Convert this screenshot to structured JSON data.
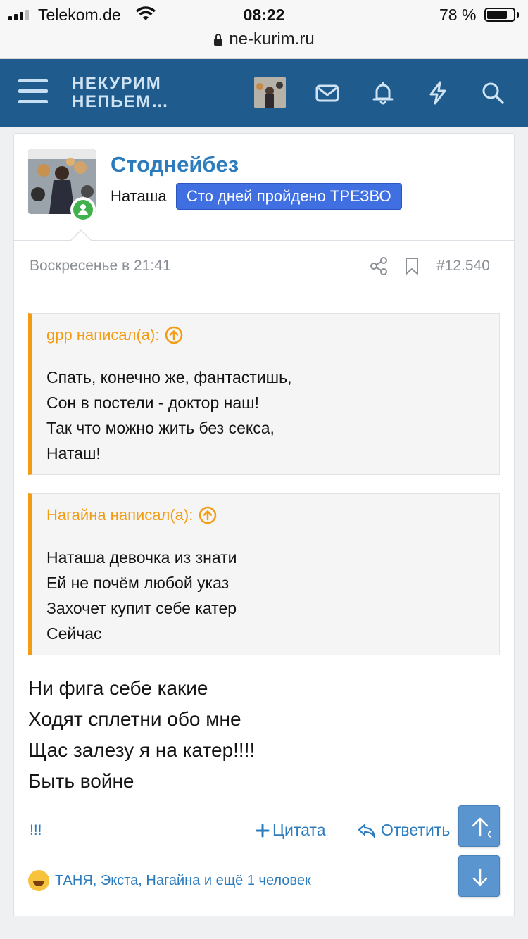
{
  "status_bar": {
    "carrier": "Telekom.de",
    "time": "08:22",
    "battery_percent": "78 %",
    "battery_level": 0.78
  },
  "browser": {
    "url": "ne-kurim.ru"
  },
  "header": {
    "logo_line1": "НЕКУРИМ",
    "logo_line2": "НЕПЬЕМ…",
    "icons": [
      "menu-icon",
      "mail-icon",
      "bell-icon",
      "bolt-icon",
      "search-icon"
    ]
  },
  "post": {
    "username": "Стоднейбез",
    "user_title": "Наташа",
    "user_badge": "Сто дней пройдено ТРЕЗВО",
    "date": "Воскресенье в 21:41",
    "post_number": "#12.540",
    "quotes": [
      {
        "author": "gpp написал(а):",
        "lines": [
          "Спать, конечно же, фантастишь,",
          "Сон в постели - доктор наш!",
          "Так что можно жить без секса,",
          "Наташ!"
        ]
      },
      {
        "author": "Нагайна написал(а):",
        "lines": [
          "Наташа девочка из знати",
          "Ей не почём любой указ",
          "Захочет купит себе катер",
          "Сейчас"
        ]
      }
    ],
    "message_lines": [
      "Ни фига себе какие",
      "Ходят сплетни обо мне",
      "Щас залезу я на катер!!!!",
      "Быть войне"
    ],
    "actions": {
      "report": "!!!",
      "quote": "Цитата",
      "reply": "Ответить"
    },
    "reactions": "ТАНЯ, Экста, Нагайна и ещё 1 человек"
  },
  "colors": {
    "header_bg": "#1f5c8d",
    "link": "#2c7cbd",
    "quote_accent": "#f39c12",
    "badge": "#3f6fe0",
    "online": "#3fb24b"
  }
}
